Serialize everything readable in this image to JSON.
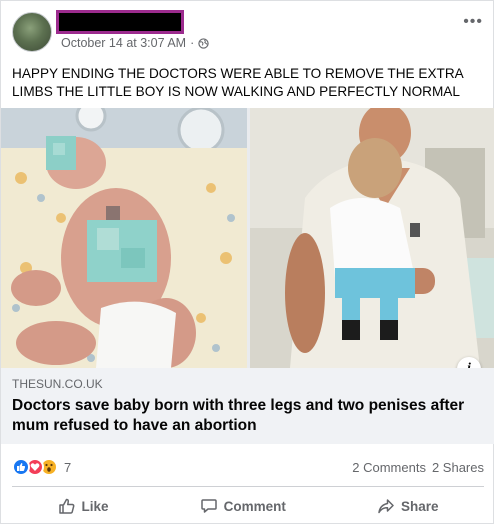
{
  "post": {
    "timestamp": "October 14 at 3:07 AM",
    "separator": "·",
    "text": "HAPPY ENDING THE DOCTORS WERE ABLE TO REMOVE THE EXTRA LIMBS THE LITTLE BOY IS NOW WALKING AND PERFECTLY NORMAL"
  },
  "link": {
    "domain": "THESUN.CO.UK",
    "title": "Doctors save baby born with three legs and two penises after mum refused to have an abortion"
  },
  "engagement": {
    "reaction_count": "7",
    "comments": "2 Comments",
    "shares": "2 Shares"
  },
  "actions": {
    "like": "Like",
    "comment": "Comment",
    "share": "Share"
  },
  "icons": {
    "more": "more-options-icon",
    "privacy": "globe-icon",
    "info": "info-icon"
  }
}
